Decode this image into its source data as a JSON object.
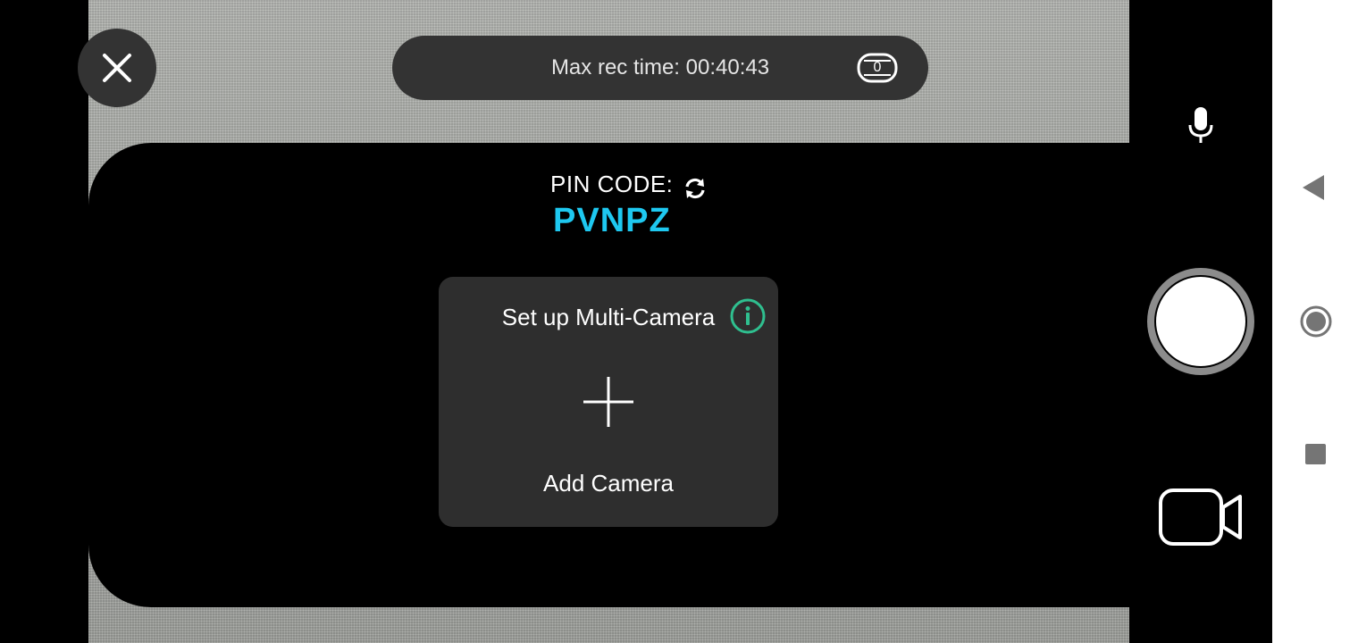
{
  "recording": {
    "max_rec_time_text": "Max rec time: 00:40:43",
    "counter": "0"
  },
  "pin": {
    "label": "PIN CODE:",
    "code": "PVNPZ"
  },
  "multi_camera_card": {
    "title": "Set up Multi-Camera",
    "add_label": "Add Camera"
  },
  "colors": {
    "pin_code": "#1ec8f0",
    "info_icon": "#2fbf8f",
    "panel": "#000000",
    "card": "#2e2e2e"
  },
  "icons": {
    "close": "close-icon",
    "counter": "clip-counter-icon",
    "refresh": "refresh-icon",
    "info": "info-icon",
    "add": "plus-icon",
    "mic": "microphone-icon",
    "shutter": "record-shutter",
    "video": "video-camera-icon",
    "back": "back-triangle-icon",
    "home": "home-circle-icon",
    "recents": "recents-square-icon"
  }
}
